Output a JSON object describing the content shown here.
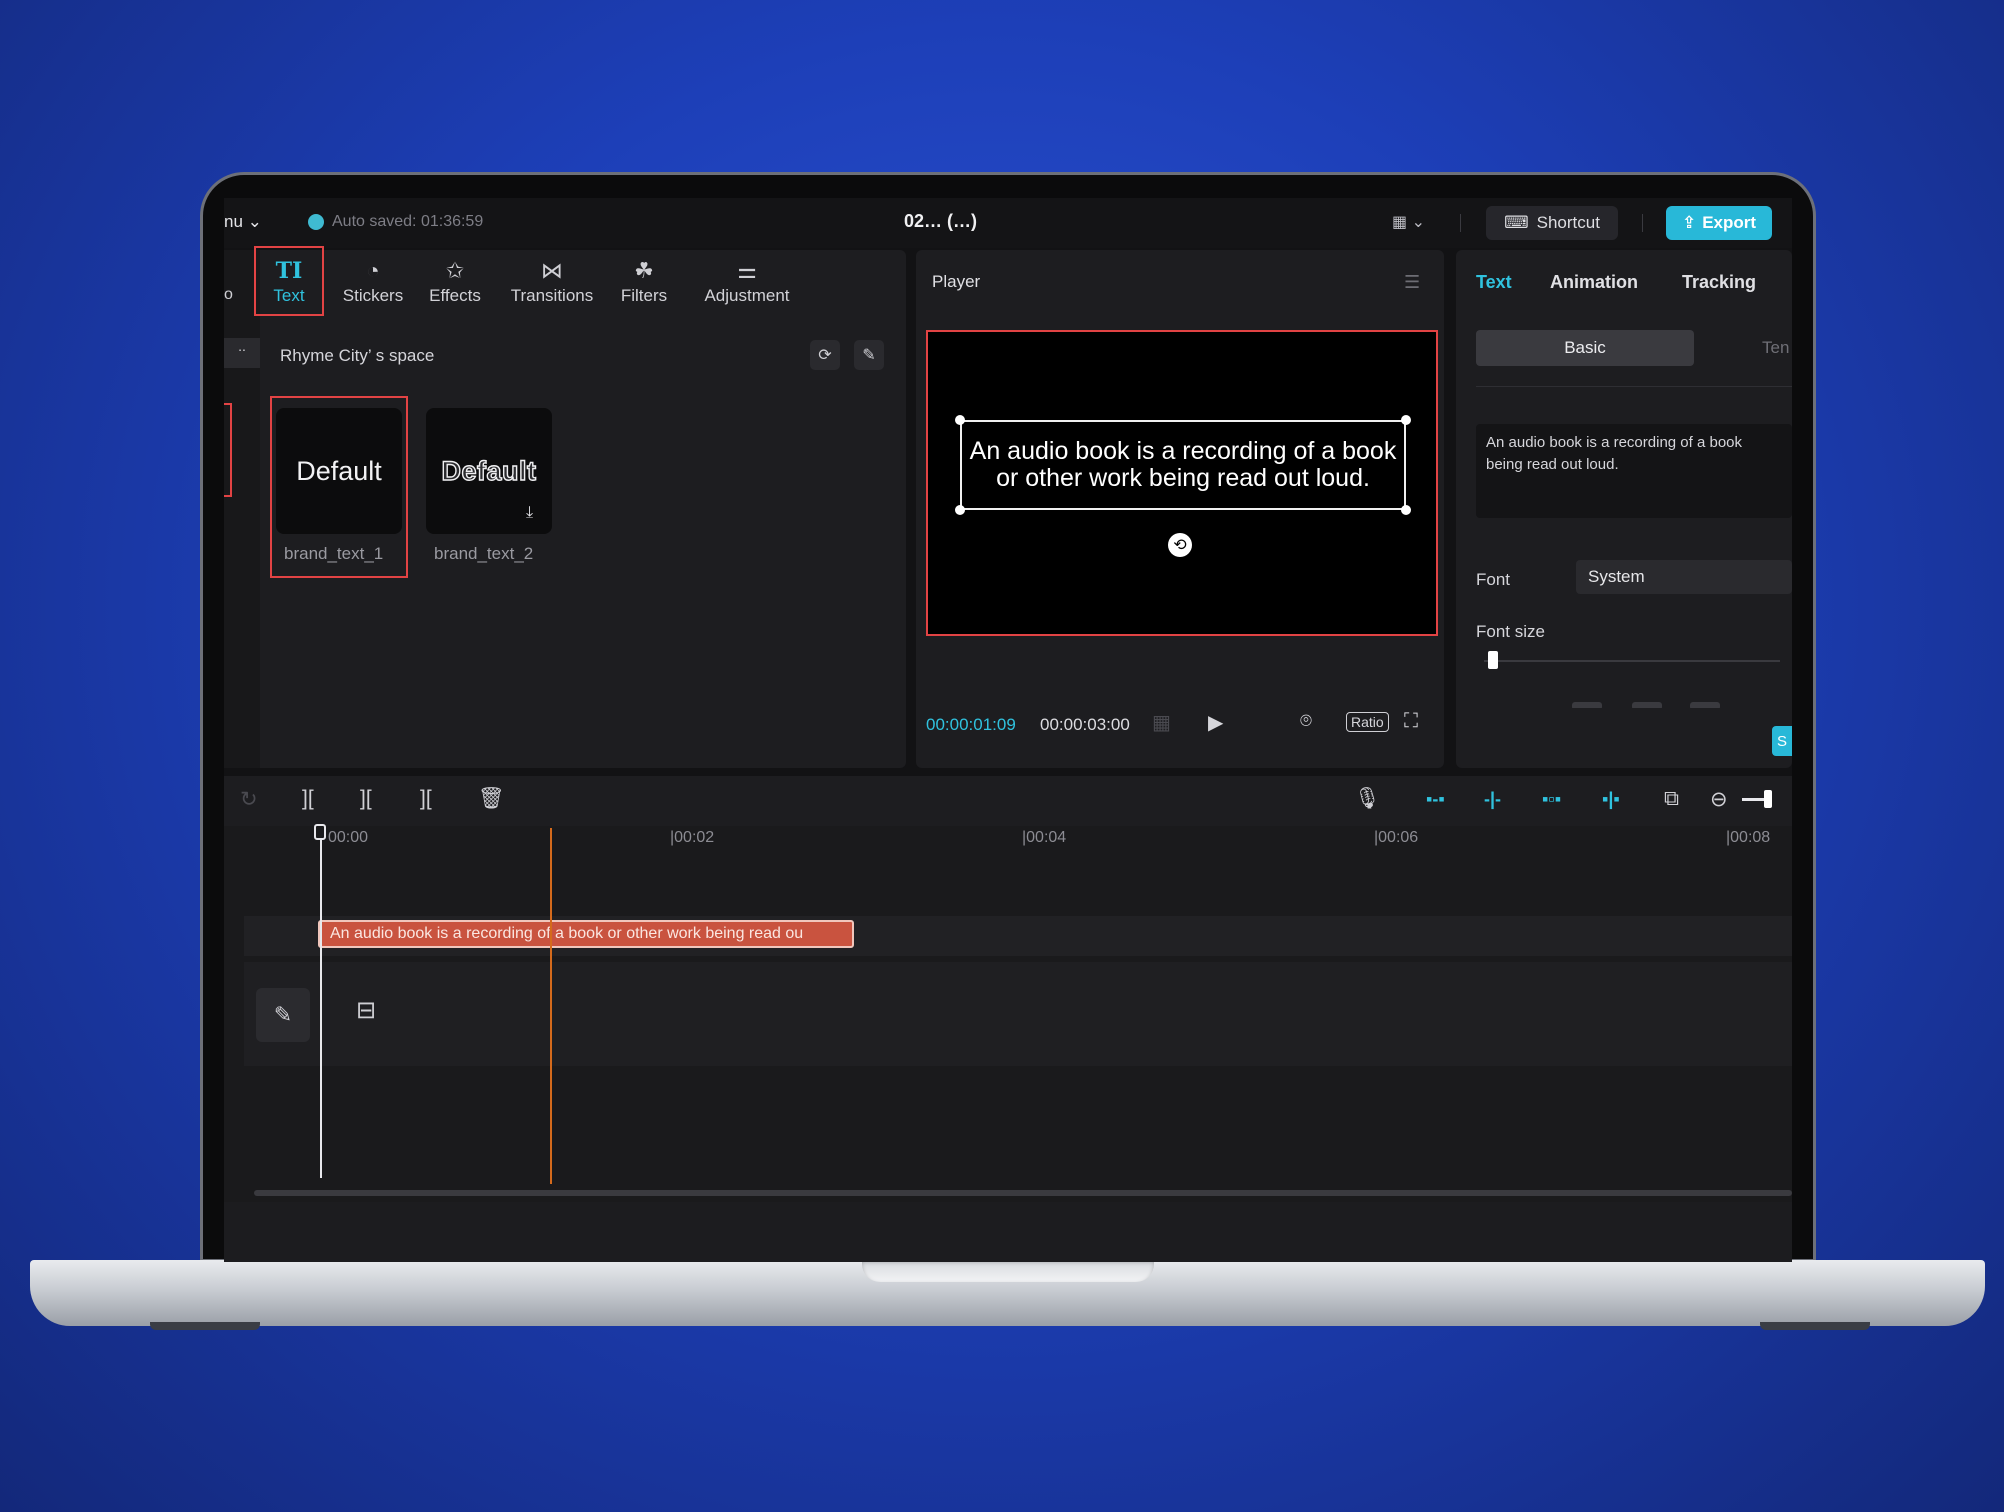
{
  "topbar": {
    "menu_label": "nu",
    "autosave": "Auto saved: 01:36:59",
    "project_title": "02… (…)",
    "shortcut_label": "Shortcut",
    "export_label": "Export"
  },
  "toolbar": {
    "tools": [
      {
        "label": "Text",
        "icon": "TI"
      },
      {
        "label": "Stickers",
        "icon": "sticker-icon"
      },
      {
        "label": "Effects",
        "icon": "effects-icon"
      },
      {
        "label": "Transitions",
        "icon": "transitions-icon"
      },
      {
        "label": "Filters",
        "icon": "filters-icon"
      },
      {
        "label": "Adjustment",
        "icon": "adjustment-icon"
      }
    ],
    "partial_left": "o"
  },
  "library": {
    "space_title": "Rhyme City’ s space",
    "cards": [
      {
        "preview": "Default",
        "label": "brand_text_1"
      },
      {
        "preview": "Default",
        "label": "brand_text_2"
      }
    ]
  },
  "player": {
    "title": "Player",
    "caption": "An audio book is a recording of a book or other work being read out loud.",
    "current_time": "00:00:01:09",
    "total_time": "00:00:03:00",
    "ratio_label": "Ratio"
  },
  "inspector": {
    "tabs": [
      "Text",
      "Animation",
      "Tracking"
    ],
    "segment_basic": "Basic",
    "segment_template": "Ten",
    "text_value": "An audio book is a recording of a book being read out loud.",
    "font_label": "Font",
    "font_value": "System",
    "font_size_label": "Font size",
    "apply_partial": "S"
  },
  "timeline": {
    "ruler": [
      "00:00",
      "|00:02",
      "|00:04",
      "|00:06",
      "|00:08"
    ],
    "clip_text": "An audio book is a recording of a book or other work being read ou"
  },
  "colors": {
    "accent": "#30c2de",
    "highlight": "#e24344",
    "clip": "#c9533f",
    "background": "#1d3fb8"
  }
}
